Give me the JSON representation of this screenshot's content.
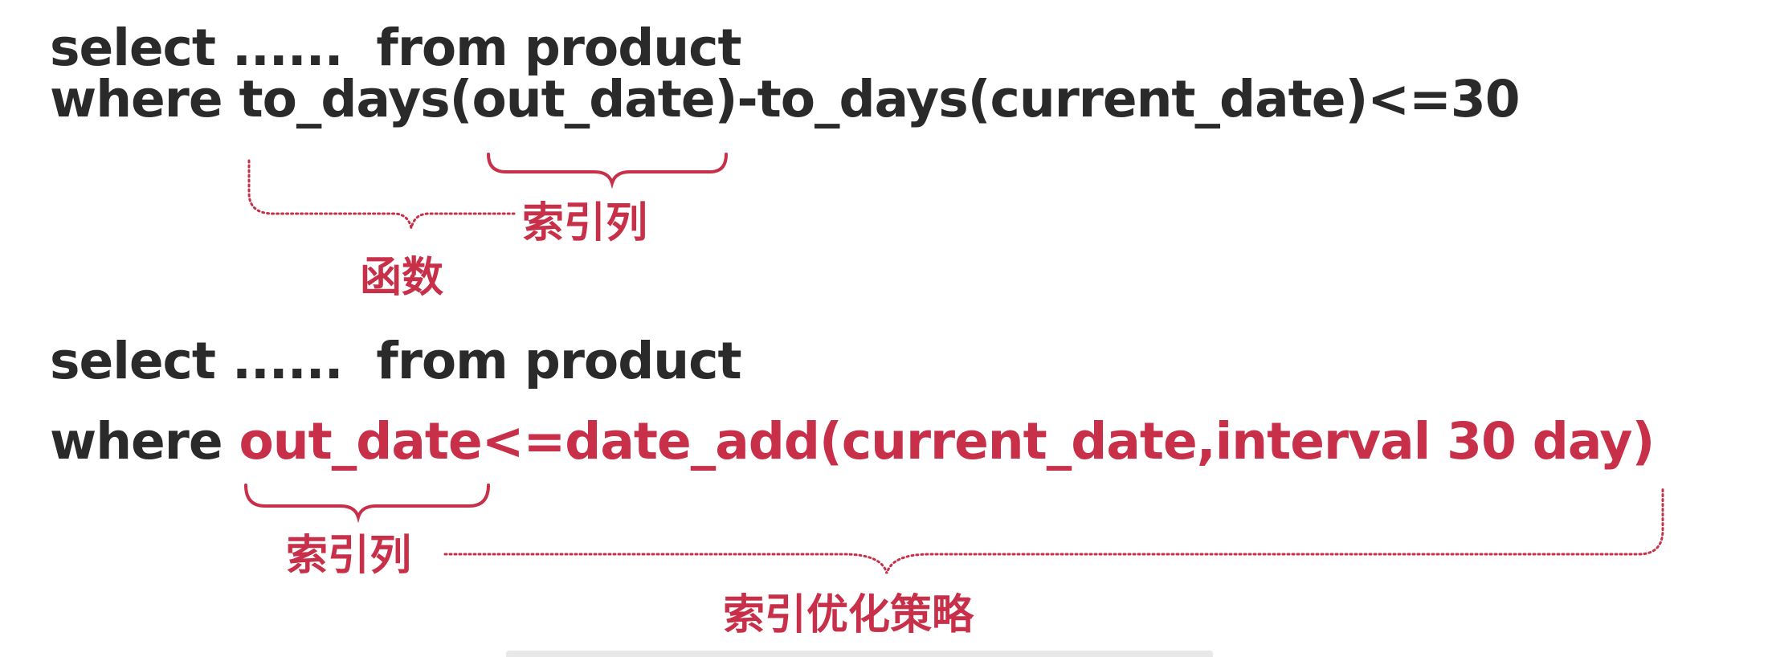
{
  "query1": {
    "line1": "select ......  from product",
    "line2_where": "where ",
    "line2_fn_open": "to_days(",
    "line2_col": "out_date",
    "line2_rest": ")-to_days(current_date)<=30"
  },
  "query1_labels": {
    "index_column": "索引列",
    "function": "函数"
  },
  "query2": {
    "line1": "select ......  from product",
    "line2_where": "where ",
    "line2_col": "out_date",
    "line2_rest": "<=date_add(current_date,interval 30 day)"
  },
  "query2_labels": {
    "index_column": "索引列",
    "strategy": "索引优化策略"
  },
  "colors": {
    "text": "#2a2a2a",
    "accent": "#c8304a"
  }
}
